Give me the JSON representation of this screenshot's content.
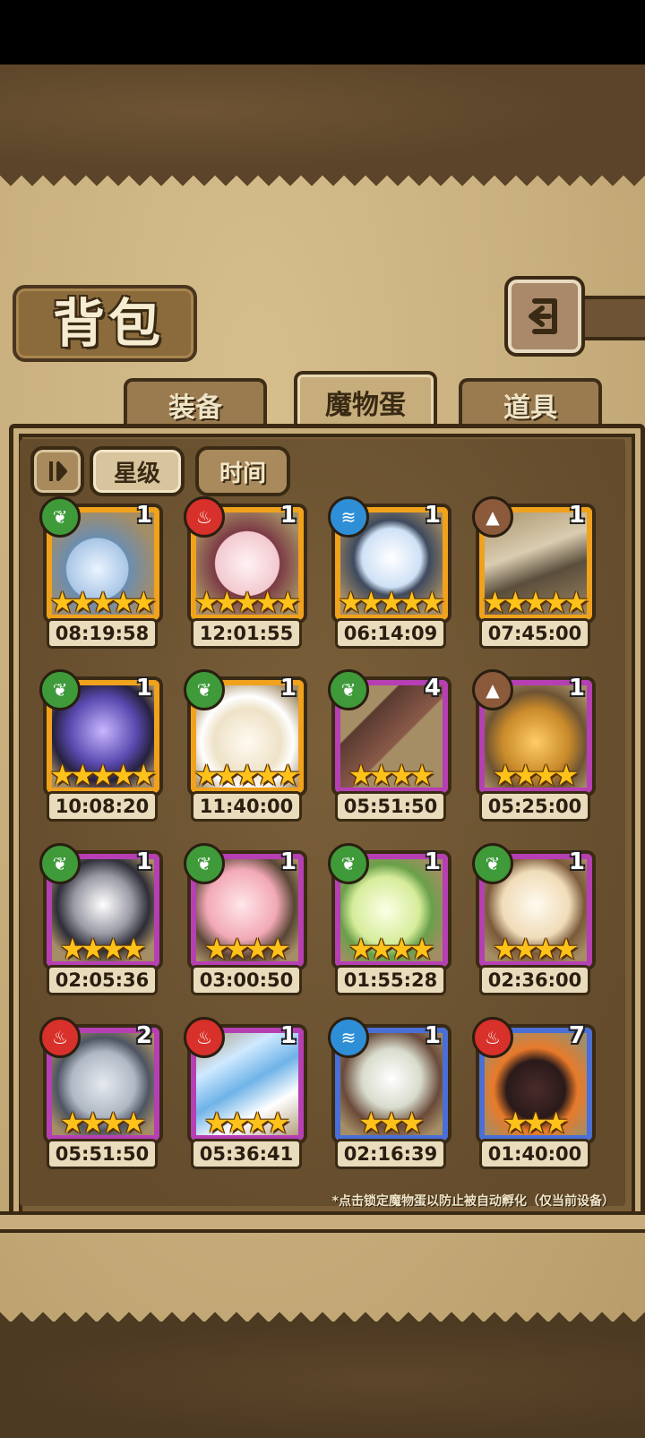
{
  "screen": {
    "title": "背包"
  },
  "tabs": [
    {
      "label": "装备",
      "active": false
    },
    {
      "label": "魔物蛋",
      "active": true
    },
    {
      "label": "道具",
      "active": false
    }
  ],
  "sort": {
    "toggle_icon": "sort-toggle-icon",
    "star_label": "星级",
    "time_label": "时间",
    "selected": "星级"
  },
  "eggs": [
    {
      "element": "grass",
      "count": "1",
      "stars": "★★★★★",
      "timer": "08:19:58",
      "rarity": "gold",
      "art": "pocket-watch"
    },
    {
      "element": "fire",
      "count": "1",
      "stars": "★★★★★",
      "timer": "12:01:55",
      "rarity": "gold",
      "art": "lotus"
    },
    {
      "element": "water",
      "count": "1",
      "stars": "★★★★★",
      "timer": "06:14:09",
      "rarity": "gold",
      "art": "crystal-orb"
    },
    {
      "element": "earth",
      "count": "1",
      "stars": "★★★★★",
      "timer": "07:45:00",
      "rarity": "gold",
      "art": "pyramid"
    },
    {
      "element": "grass",
      "count": "1",
      "stars": "★★★★★",
      "timer": "10:08:20",
      "rarity": "gold",
      "art": "rune-egg"
    },
    {
      "element": "grass",
      "count": "1",
      "stars": "★★★★★",
      "timer": "11:40:00",
      "rarity": "gold",
      "art": "angel-egg"
    },
    {
      "element": "grass",
      "count": "4",
      "stars": "★★★★",
      "timer": "05:51:50",
      "rarity": "purple",
      "art": "kunai"
    },
    {
      "element": "earth",
      "count": "1",
      "stars": "★★★★",
      "timer": "05:25:00",
      "rarity": "purple",
      "art": "furball"
    },
    {
      "element": "grass",
      "count": "1",
      "stars": "★★★★",
      "timer": "02:05:36",
      "rarity": "purple",
      "art": "spiked-egg"
    },
    {
      "element": "grass",
      "count": "1",
      "stars": "★★★★",
      "timer": "03:00:50",
      "rarity": "purple",
      "art": "pink-bunny"
    },
    {
      "element": "grass",
      "count": "1",
      "stars": "★★★★",
      "timer": "01:55:28",
      "rarity": "purple",
      "art": "leaf-egg"
    },
    {
      "element": "grass",
      "count": "1",
      "stars": "★★★★",
      "timer": "02:36:00",
      "rarity": "purple",
      "art": "nest-egg"
    },
    {
      "element": "fire",
      "count": "2",
      "stars": "★★★★",
      "timer": "05:51:50",
      "rarity": "purple",
      "art": "shield"
    },
    {
      "element": "fire",
      "count": "1",
      "stars": "★★★★",
      "timer": "05:36:41",
      "rarity": "purple",
      "art": "ice-flags"
    },
    {
      "element": "water",
      "count": "1",
      "stars": "★★★",
      "timer": "02:16:39",
      "rarity": "blue",
      "art": "skull-egg"
    },
    {
      "element": "fire",
      "count": "7",
      "stars": "★★★",
      "timer": "01:40:00",
      "rarity": "blue",
      "art": "flame-egg"
    }
  ],
  "footnote": "*点击锁定魔物蛋以防止被自动孵化（仅当前设备）",
  "colors": {
    "gold_frame": "#f0a21c",
    "purple_frame": "#b63fb4",
    "blue_frame": "#4a6fd6",
    "grass": "#3f9a3a",
    "fire": "#d8302a",
    "water": "#2f8fd6",
    "earth": "#8a5a3a"
  }
}
